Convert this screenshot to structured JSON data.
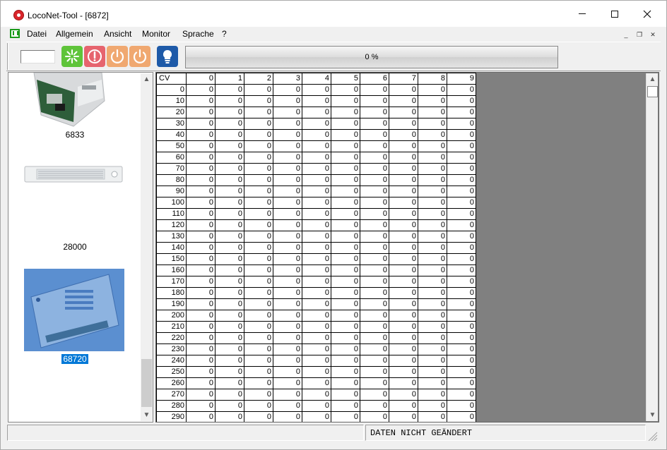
{
  "window": {
    "title": "LocoNet-Tool - [6872]"
  },
  "menu": {
    "items": [
      "Datei",
      "Allgemein",
      "Ansicht",
      "Monitor",
      "Sprache",
      "?"
    ]
  },
  "toolbar": {
    "address_input_value": "",
    "progress_text": "0 %",
    "progress_fraction": 0,
    "buttons": [
      {
        "name": "go-button",
        "icon": "star-burst-icon",
        "color": "#5fc43a"
      },
      {
        "name": "stop-button",
        "icon": "stop-exclamation-icon",
        "color": "#e6646e"
      },
      {
        "name": "power-on-button",
        "icon": "power-icon",
        "color": "#f0a870"
      },
      {
        "name": "power-off-button",
        "icon": "power-icon",
        "color": "#f0a870"
      },
      {
        "name": "info-button",
        "icon": "lightbulb-icon",
        "color": "#1e5aa8"
      }
    ]
  },
  "devices": [
    {
      "label": "6833",
      "selected": false
    },
    {
      "label": "28000",
      "selected": false
    },
    {
      "label": "68720",
      "selected": true
    }
  ],
  "grid": {
    "corner_header": "CV",
    "column_headers": [
      "0",
      "1",
      "2",
      "3",
      "4",
      "5",
      "6",
      "7",
      "8",
      "9"
    ],
    "rows": [
      {
        "cv": "0",
        "values": [
          "0",
          "0",
          "0",
          "0",
          "0",
          "0",
          "0",
          "0",
          "0",
          "0"
        ]
      },
      {
        "cv": "10",
        "values": [
          "0",
          "0",
          "0",
          "0",
          "0",
          "0",
          "0",
          "0",
          "0",
          "0"
        ]
      },
      {
        "cv": "20",
        "values": [
          "0",
          "0",
          "0",
          "0",
          "0",
          "0",
          "0",
          "0",
          "0",
          "0"
        ]
      },
      {
        "cv": "30",
        "values": [
          "0",
          "0",
          "0",
          "0",
          "0",
          "0",
          "0",
          "0",
          "0",
          "0"
        ]
      },
      {
        "cv": "40",
        "values": [
          "0",
          "0",
          "0",
          "0",
          "0",
          "0",
          "0",
          "0",
          "0",
          "0"
        ]
      },
      {
        "cv": "50",
        "values": [
          "0",
          "0",
          "0",
          "0",
          "0",
          "0",
          "0",
          "0",
          "0",
          "0"
        ]
      },
      {
        "cv": "60",
        "values": [
          "0",
          "0",
          "0",
          "0",
          "0",
          "0",
          "0",
          "0",
          "0",
          "0"
        ]
      },
      {
        "cv": "70",
        "values": [
          "0",
          "0",
          "0",
          "0",
          "0",
          "0",
          "0",
          "0",
          "0",
          "0"
        ]
      },
      {
        "cv": "80",
        "values": [
          "0",
          "0",
          "0",
          "0",
          "0",
          "0",
          "0",
          "0",
          "0",
          "0"
        ]
      },
      {
        "cv": "90",
        "values": [
          "0",
          "0",
          "0",
          "0",
          "0",
          "0",
          "0",
          "0",
          "0",
          "0"
        ]
      },
      {
        "cv": "100",
        "values": [
          "0",
          "0",
          "0",
          "0",
          "0",
          "0",
          "0",
          "0",
          "0",
          "0"
        ]
      },
      {
        "cv": "110",
        "values": [
          "0",
          "0",
          "0",
          "0",
          "0",
          "0",
          "0",
          "0",
          "0",
          "0"
        ]
      },
      {
        "cv": "120",
        "values": [
          "0",
          "0",
          "0",
          "0",
          "0",
          "0",
          "0",
          "0",
          "0",
          "0"
        ]
      },
      {
        "cv": "130",
        "values": [
          "0",
          "0",
          "0",
          "0",
          "0",
          "0",
          "0",
          "0",
          "0",
          "0"
        ]
      },
      {
        "cv": "140",
        "values": [
          "0",
          "0",
          "0",
          "0",
          "0",
          "0",
          "0",
          "0",
          "0",
          "0"
        ]
      },
      {
        "cv": "150",
        "values": [
          "0",
          "0",
          "0",
          "0",
          "0",
          "0",
          "0",
          "0",
          "0",
          "0"
        ]
      },
      {
        "cv": "160",
        "values": [
          "0",
          "0",
          "0",
          "0",
          "0",
          "0",
          "0",
          "0",
          "0",
          "0"
        ]
      },
      {
        "cv": "170",
        "values": [
          "0",
          "0",
          "0",
          "0",
          "0",
          "0",
          "0",
          "0",
          "0",
          "0"
        ]
      },
      {
        "cv": "180",
        "values": [
          "0",
          "0",
          "0",
          "0",
          "0",
          "0",
          "0",
          "0",
          "0",
          "0"
        ]
      },
      {
        "cv": "190",
        "values": [
          "0",
          "0",
          "0",
          "0",
          "0",
          "0",
          "0",
          "0",
          "0",
          "0"
        ]
      },
      {
        "cv": "200",
        "values": [
          "0",
          "0",
          "0",
          "0",
          "0",
          "0",
          "0",
          "0",
          "0",
          "0"
        ]
      },
      {
        "cv": "210",
        "values": [
          "0",
          "0",
          "0",
          "0",
          "0",
          "0",
          "0",
          "0",
          "0",
          "0"
        ]
      },
      {
        "cv": "220",
        "values": [
          "0",
          "0",
          "0",
          "0",
          "0",
          "0",
          "0",
          "0",
          "0",
          "0"
        ]
      },
      {
        "cv": "230",
        "values": [
          "0",
          "0",
          "0",
          "0",
          "0",
          "0",
          "0",
          "0",
          "0",
          "0"
        ]
      },
      {
        "cv": "240",
        "values": [
          "0",
          "0",
          "0",
          "0",
          "0",
          "0",
          "0",
          "0",
          "0",
          "0"
        ]
      },
      {
        "cv": "250",
        "values": [
          "0",
          "0",
          "0",
          "0",
          "0",
          "0",
          "0",
          "0",
          "0",
          "0"
        ]
      },
      {
        "cv": "260",
        "values": [
          "0",
          "0",
          "0",
          "0",
          "0",
          "0",
          "0",
          "0",
          "0",
          "0"
        ]
      },
      {
        "cv": "270",
        "values": [
          "0",
          "0",
          "0",
          "0",
          "0",
          "0",
          "0",
          "0",
          "0",
          "0"
        ]
      },
      {
        "cv": "280",
        "values": [
          "0",
          "0",
          "0",
          "0",
          "0",
          "0",
          "0",
          "0",
          "0",
          "0"
        ]
      },
      {
        "cv": "290",
        "values": [
          "0",
          "0",
          "0",
          "0",
          "0",
          "0",
          "0",
          "0",
          "0",
          "0"
        ]
      }
    ]
  },
  "status": {
    "left": "",
    "right": "DATEN NICHT GEÄNDERT"
  }
}
